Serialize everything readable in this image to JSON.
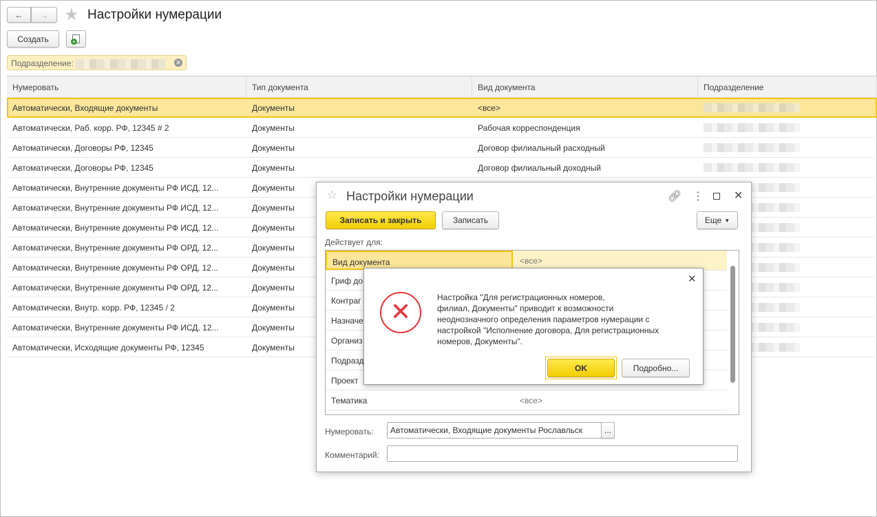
{
  "header": {
    "title": "Настройки нумерации",
    "back": "←",
    "forward": "→"
  },
  "toolbar": {
    "create_label": "Создать"
  },
  "filter": {
    "label": "Подразделение:"
  },
  "table": {
    "columns": [
      "Нумеровать",
      "Тип документа",
      "Вид документа",
      "Подразделение"
    ],
    "rows": [
      [
        "Автоматически, Входящие документы",
        "Документы",
        "<все>"
      ],
      [
        "Автоматически, Раб. корр. РФ, 12345 # 2",
        "Документы",
        "Рабочая корреспонденция"
      ],
      [
        "Автоматически, Договоры РФ, 12345",
        "Документы",
        "Договор филиальный расходный"
      ],
      [
        "Автоматически, Договоры РФ, 12345",
        "Документы",
        "Договор филиальный доходный"
      ],
      [
        "Автоматически, Внутренние документы РФ ИСД, 12...",
        "Документы",
        ""
      ],
      [
        "Автоматически, Внутренние документы РФ ИСД, 12...",
        "Документы",
        ""
      ],
      [
        "Автоматически, Внутренние документы РФ ИСД, 12...",
        "Документы",
        ""
      ],
      [
        "Автоматически, Внутренние документы РФ ОРД, 12...",
        "Документы",
        ""
      ],
      [
        "Автоматически, Внутренние документы РФ ОРД, 12...",
        "Документы",
        ""
      ],
      [
        "Автоматически, Внутренние документы РФ ОРД, 12...",
        "Документы",
        ""
      ],
      [
        "Автоматически, Внутр. корр. РФ, 12345 / 2",
        "Документы",
        ""
      ],
      [
        "Автоматически, Внутренние документы РФ ИСД, 12...",
        "Документы",
        ""
      ],
      [
        "Автоматически, Исходящие документы РФ, 12345",
        "Документы",
        ""
      ]
    ]
  },
  "dialog": {
    "title": "Настройки нумерации",
    "save_close": "Записать и закрыть",
    "save": "Записать",
    "more": "Еще",
    "applies_label": "Действует для:",
    "params": [
      {
        "name": "Вид документа",
        "value": "<все>"
      },
      {
        "name": "Гриф до",
        "value": ""
      },
      {
        "name": "Контраг",
        "value": ""
      },
      {
        "name": "Назначе",
        "value": ""
      },
      {
        "name": "Организ",
        "value": ""
      },
      {
        "name": "Подразд",
        "value": ""
      },
      {
        "name": "Проект",
        "value": ""
      },
      {
        "name": "Тематика",
        "value": "<все>"
      }
    ],
    "numbering_label": "Нумеровать:",
    "numbering_value": "Автоматически, Входящие документы Рославльск",
    "comment_label": "Комментарий:",
    "comment_value": "",
    "ellipsis": "..."
  },
  "error": {
    "lines": [
      "Настройка \"Для регистрационных номеров,",
      "филиал, Документы\" приводит к возможности",
      "неоднозначного определения параметров нумерации с",
      "настройкой \"Исполнение договора, Для регистрационных",
      "номеров, Документы\"."
    ],
    "ok": "OK",
    "details": "Подробно..."
  },
  "colors": {
    "accent_yellow": "#f5c60f",
    "selection": "#fbe69a",
    "error_red": "#e8343a"
  }
}
